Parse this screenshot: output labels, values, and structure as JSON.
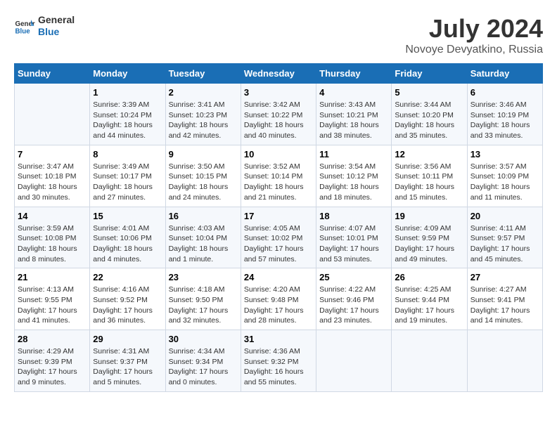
{
  "header": {
    "logo_text_general": "General",
    "logo_text_blue": "Blue",
    "month_year": "July 2024",
    "location": "Novoye Devyatkino, Russia"
  },
  "days_of_week": [
    "Sunday",
    "Monday",
    "Tuesday",
    "Wednesday",
    "Thursday",
    "Friday",
    "Saturday"
  ],
  "weeks": [
    [
      {
        "day": "",
        "info": ""
      },
      {
        "day": "1",
        "info": "Sunrise: 3:39 AM\nSunset: 10:24 PM\nDaylight: 18 hours\nand 44 minutes."
      },
      {
        "day": "2",
        "info": "Sunrise: 3:41 AM\nSunset: 10:23 PM\nDaylight: 18 hours\nand 42 minutes."
      },
      {
        "day": "3",
        "info": "Sunrise: 3:42 AM\nSunset: 10:22 PM\nDaylight: 18 hours\nand 40 minutes."
      },
      {
        "day": "4",
        "info": "Sunrise: 3:43 AM\nSunset: 10:21 PM\nDaylight: 18 hours\nand 38 minutes."
      },
      {
        "day": "5",
        "info": "Sunrise: 3:44 AM\nSunset: 10:20 PM\nDaylight: 18 hours\nand 35 minutes."
      },
      {
        "day": "6",
        "info": "Sunrise: 3:46 AM\nSunset: 10:19 PM\nDaylight: 18 hours\nand 33 minutes."
      }
    ],
    [
      {
        "day": "7",
        "info": "Sunrise: 3:47 AM\nSunset: 10:18 PM\nDaylight: 18 hours\nand 30 minutes."
      },
      {
        "day": "8",
        "info": "Sunrise: 3:49 AM\nSunset: 10:17 PM\nDaylight: 18 hours\nand 27 minutes."
      },
      {
        "day": "9",
        "info": "Sunrise: 3:50 AM\nSunset: 10:15 PM\nDaylight: 18 hours\nand 24 minutes."
      },
      {
        "day": "10",
        "info": "Sunrise: 3:52 AM\nSunset: 10:14 PM\nDaylight: 18 hours\nand 21 minutes."
      },
      {
        "day": "11",
        "info": "Sunrise: 3:54 AM\nSunset: 10:12 PM\nDaylight: 18 hours\nand 18 minutes."
      },
      {
        "day": "12",
        "info": "Sunrise: 3:56 AM\nSunset: 10:11 PM\nDaylight: 18 hours\nand 15 minutes."
      },
      {
        "day": "13",
        "info": "Sunrise: 3:57 AM\nSunset: 10:09 PM\nDaylight: 18 hours\nand 11 minutes."
      }
    ],
    [
      {
        "day": "14",
        "info": "Sunrise: 3:59 AM\nSunset: 10:08 PM\nDaylight: 18 hours\nand 8 minutes."
      },
      {
        "day": "15",
        "info": "Sunrise: 4:01 AM\nSunset: 10:06 PM\nDaylight: 18 hours\nand 4 minutes."
      },
      {
        "day": "16",
        "info": "Sunrise: 4:03 AM\nSunset: 10:04 PM\nDaylight: 18 hours\nand 1 minute."
      },
      {
        "day": "17",
        "info": "Sunrise: 4:05 AM\nSunset: 10:02 PM\nDaylight: 17 hours\nand 57 minutes."
      },
      {
        "day": "18",
        "info": "Sunrise: 4:07 AM\nSunset: 10:01 PM\nDaylight: 17 hours\nand 53 minutes."
      },
      {
        "day": "19",
        "info": "Sunrise: 4:09 AM\nSunset: 9:59 PM\nDaylight: 17 hours\nand 49 minutes."
      },
      {
        "day": "20",
        "info": "Sunrise: 4:11 AM\nSunset: 9:57 PM\nDaylight: 17 hours\nand 45 minutes."
      }
    ],
    [
      {
        "day": "21",
        "info": "Sunrise: 4:13 AM\nSunset: 9:55 PM\nDaylight: 17 hours\nand 41 minutes."
      },
      {
        "day": "22",
        "info": "Sunrise: 4:16 AM\nSunset: 9:52 PM\nDaylight: 17 hours\nand 36 minutes."
      },
      {
        "day": "23",
        "info": "Sunrise: 4:18 AM\nSunset: 9:50 PM\nDaylight: 17 hours\nand 32 minutes."
      },
      {
        "day": "24",
        "info": "Sunrise: 4:20 AM\nSunset: 9:48 PM\nDaylight: 17 hours\nand 28 minutes."
      },
      {
        "day": "25",
        "info": "Sunrise: 4:22 AM\nSunset: 9:46 PM\nDaylight: 17 hours\nand 23 minutes."
      },
      {
        "day": "26",
        "info": "Sunrise: 4:25 AM\nSunset: 9:44 PM\nDaylight: 17 hours\nand 19 minutes."
      },
      {
        "day": "27",
        "info": "Sunrise: 4:27 AM\nSunset: 9:41 PM\nDaylight: 17 hours\nand 14 minutes."
      }
    ],
    [
      {
        "day": "28",
        "info": "Sunrise: 4:29 AM\nSunset: 9:39 PM\nDaylight: 17 hours\nand 9 minutes."
      },
      {
        "day": "29",
        "info": "Sunrise: 4:31 AM\nSunset: 9:37 PM\nDaylight: 17 hours\nand 5 minutes."
      },
      {
        "day": "30",
        "info": "Sunrise: 4:34 AM\nSunset: 9:34 PM\nDaylight: 17 hours\nand 0 minutes."
      },
      {
        "day": "31",
        "info": "Sunrise: 4:36 AM\nSunset: 9:32 PM\nDaylight: 16 hours\nand 55 minutes."
      },
      {
        "day": "",
        "info": ""
      },
      {
        "day": "",
        "info": ""
      },
      {
        "day": "",
        "info": ""
      }
    ]
  ]
}
